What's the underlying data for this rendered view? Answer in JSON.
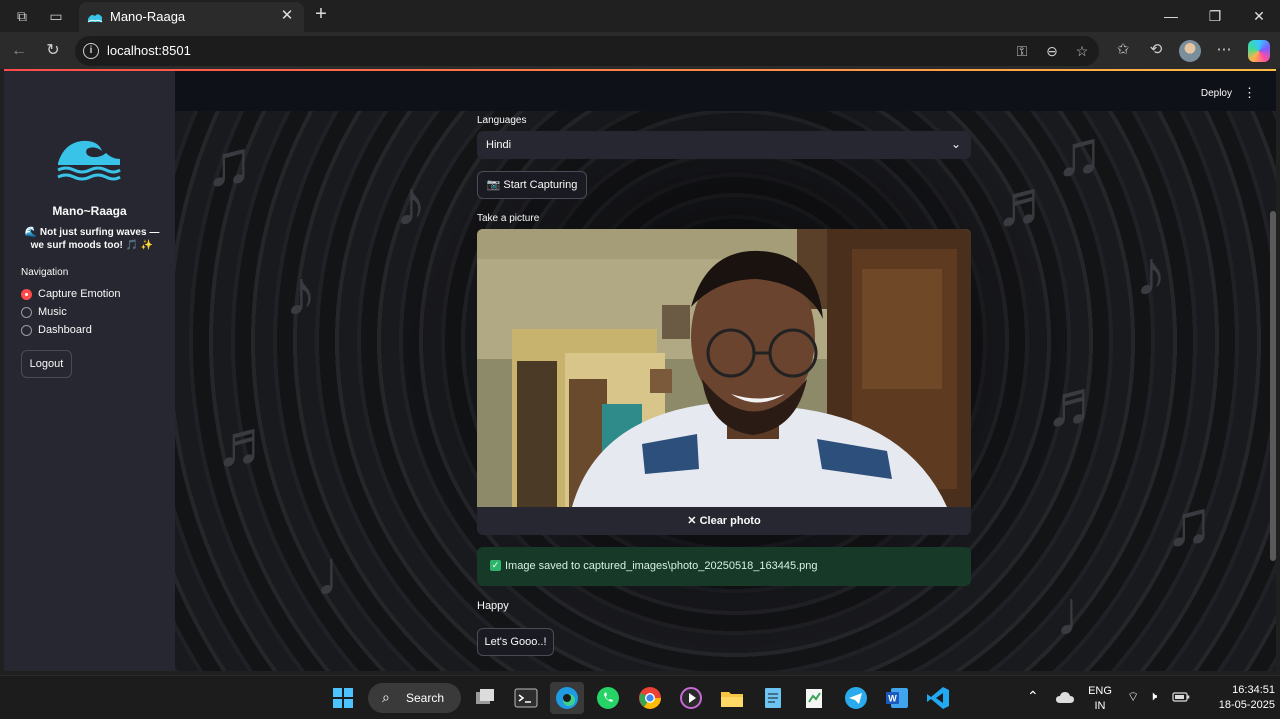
{
  "browser": {
    "tab_title": "Mano-Raaga",
    "address": "localhost:8501"
  },
  "header": {
    "deploy_label": "Deploy"
  },
  "sidebar": {
    "app_title": "Mano~Raaga",
    "tagline": "🌊 Not just surfing waves — we surf moods too! 🎵 ✨",
    "navigation_label": "Navigation",
    "nav_items": [
      {
        "label": "Capture Emotion",
        "selected": true
      },
      {
        "label": "Music",
        "selected": false
      },
      {
        "label": "Dashboard",
        "selected": false
      }
    ],
    "logout_label": "Logout"
  },
  "main": {
    "languages_label": "Languages",
    "language_selected": "Hindi",
    "start_capturing_label": "📷 Start Capturing",
    "take_picture_label": "Take a picture",
    "clear_photo_label": "✕ Clear photo",
    "success_message": "Image saved to captured_images\\photo_20250518_163445.png",
    "emotion_result": "Happy",
    "action_button_label": "Let's Gooo..!"
  },
  "taskbar": {
    "search_label": "Search",
    "lang_top": "ENG",
    "lang_bottom": "IN",
    "time": "16:34:51",
    "date": "18-05-2025"
  },
  "colors": {
    "accent": "#ff4b4b",
    "sidebar_bg": "#262730",
    "app_bg": "#0e1117",
    "success_bg": "#173928"
  }
}
